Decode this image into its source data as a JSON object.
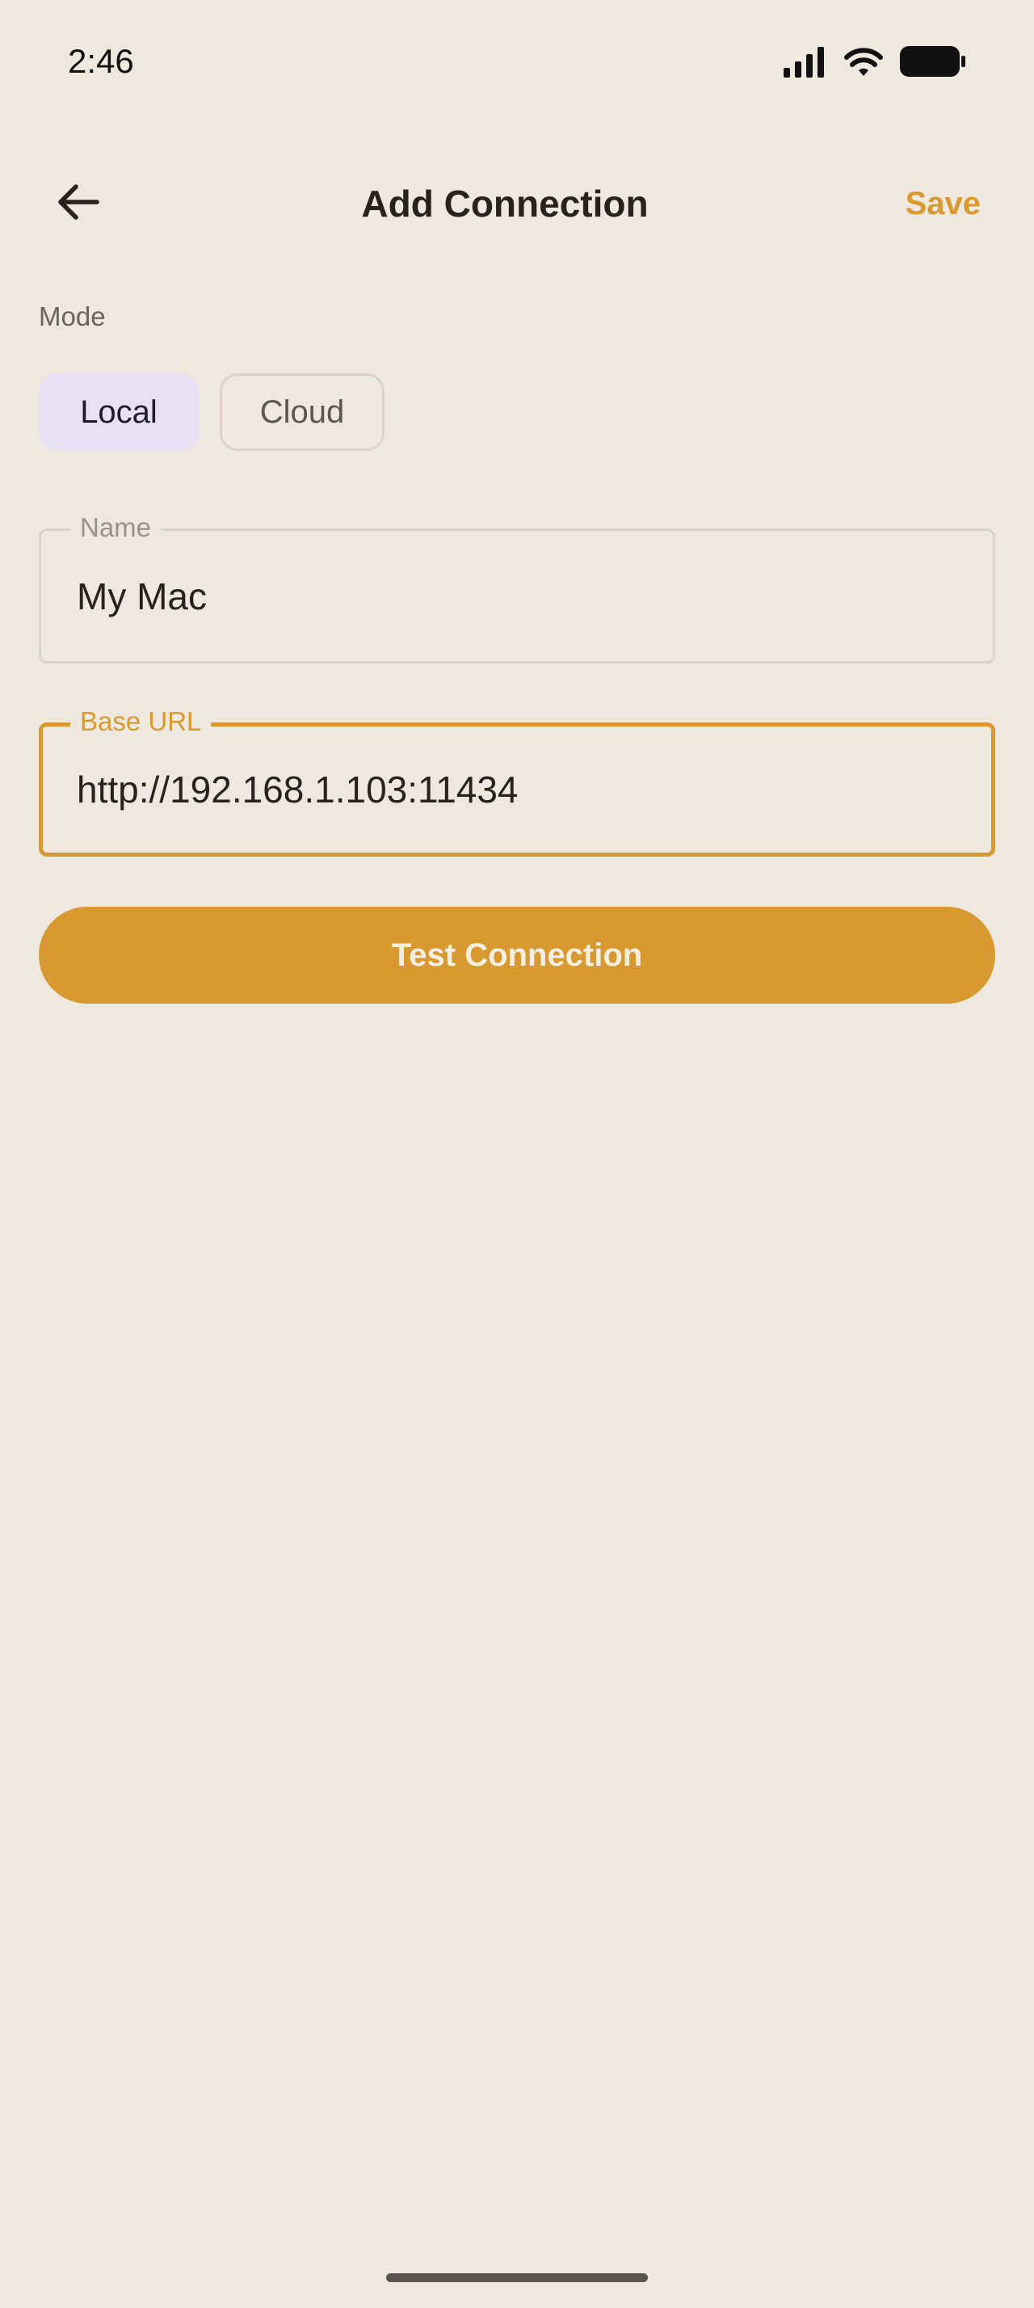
{
  "status_bar": {
    "time": "2:46",
    "icons": [
      "signal-icon",
      "wifi-icon",
      "battery-icon"
    ]
  },
  "app_bar": {
    "title": "Add Connection",
    "back_icon": "arrow-left-icon",
    "save_label": "Save"
  },
  "mode": {
    "label": "Mode",
    "options": [
      "Local",
      "Cloud"
    ],
    "selected": "Local"
  },
  "fields": {
    "name": {
      "label": "Name",
      "value": "My Mac"
    },
    "base_url": {
      "label": "Base URL",
      "value": "http://192.168.1.103:11434",
      "focused": true
    }
  },
  "test_button_label": "Test Connection",
  "colors": {
    "background": "#EFE8DF",
    "accent": "#D89A30",
    "selected_chip": "#E8E1F4",
    "text": "#2A221A"
  }
}
